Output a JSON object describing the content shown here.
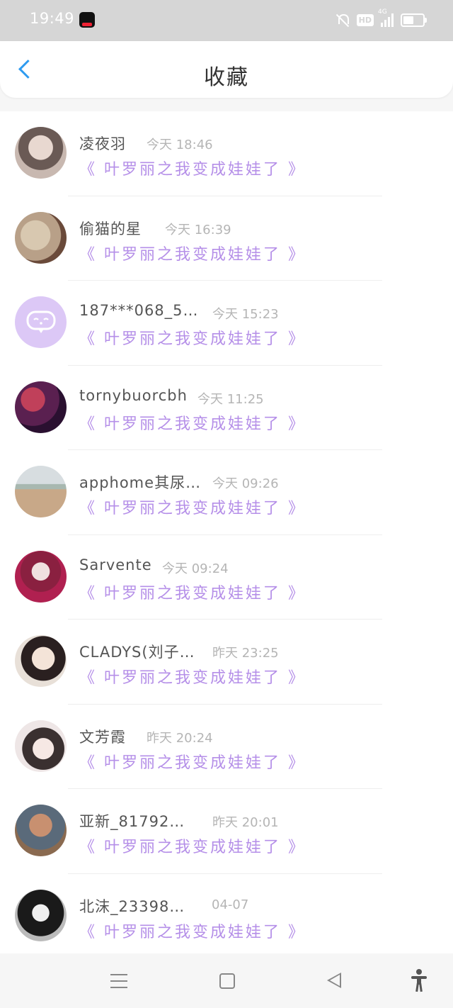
{
  "status_bar": {
    "time": "19:49",
    "network": "4G",
    "icons": [
      "tiktok-app-icon",
      "mute-icon",
      "hd-icon",
      "signal-icon",
      "battery-icon"
    ]
  },
  "header": {
    "title": "收藏",
    "back_icon": "chevron-left-icon",
    "accent_color": "#2e9bf0"
  },
  "colors": {
    "book_title": "#b58fe8",
    "name_text": "#555555",
    "time_text": "#b5b5b5"
  },
  "items": [
    {
      "name": "凌夜羽",
      "time": "今天 18:46",
      "book": "《 叶罗丽之我变成娃娃了 》",
      "avatar": "avatar-photo"
    },
    {
      "name": "偷猫的星",
      "time": "今天 16:39",
      "book": "《 叶罗丽之我变成娃娃了 》",
      "avatar": "avatar-photo"
    },
    {
      "name": "187***068_5…",
      "time": "今天 15:23",
      "book": "《 叶罗丽之我变成娃娃了 》",
      "avatar": "default-chat-avatar"
    },
    {
      "name": "tornybuorcbh",
      "time": "今天 11:25",
      "book": "《 叶罗丽之我变成娃娃了 》",
      "avatar": "avatar-photo"
    },
    {
      "name": "apphome其尿…",
      "time": "今天 09:26",
      "book": "《 叶罗丽之我变成娃娃了 》",
      "avatar": "avatar-photo"
    },
    {
      "name": "Sarvente",
      "time": "今天 09:24",
      "book": "《 叶罗丽之我变成娃娃了 》",
      "avatar": "avatar-photo"
    },
    {
      "name": "CLADYS(刘子…",
      "time": "昨天 23:25",
      "book": "《 叶罗丽之我变成娃娃了 》",
      "avatar": "avatar-photo"
    },
    {
      "name": "文芳霞",
      "time": "昨天 20:24",
      "book": "《 叶罗丽之我变成娃娃了 》",
      "avatar": "avatar-photo"
    },
    {
      "name": "亚新_81792…",
      "time": "昨天 20:01",
      "book": "《 叶罗丽之我变成娃娃了 》",
      "avatar": "avatar-photo"
    },
    {
      "name": "北沫_23398…",
      "time": "04-07",
      "book": "《 叶罗丽之我变成娃娃了 》",
      "avatar": "avatar-photo"
    }
  ],
  "bottom_nav": {
    "icons": [
      "menu-icon",
      "home-square-icon",
      "back-triangle-icon",
      "accessibility-icon"
    ]
  }
}
